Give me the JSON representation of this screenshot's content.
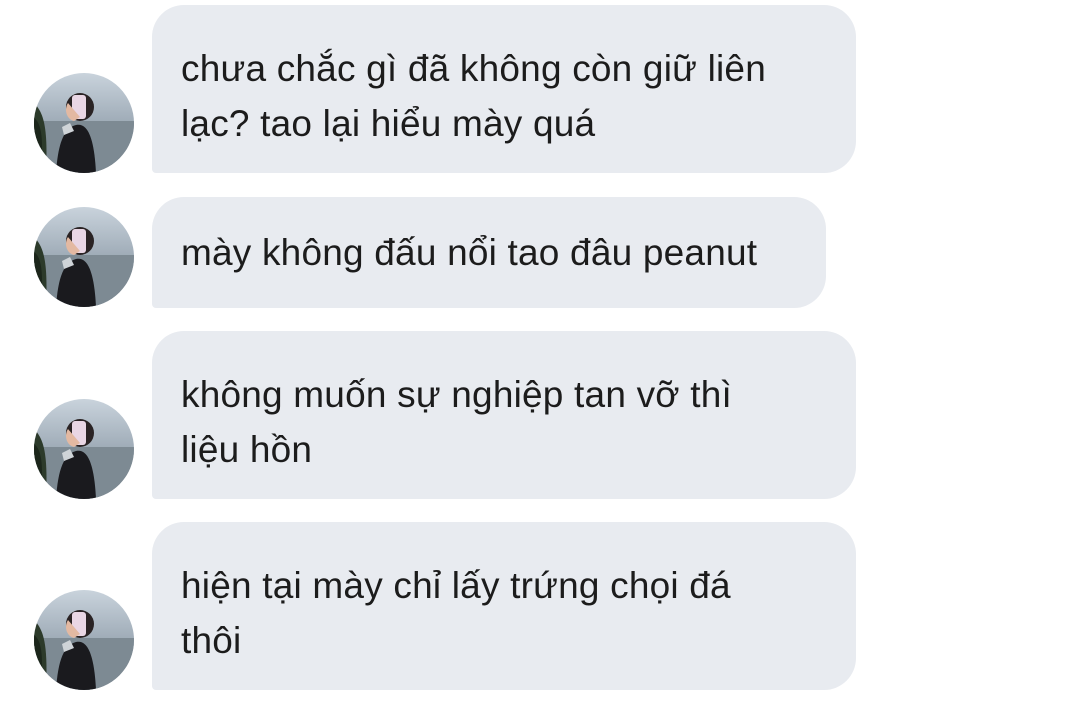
{
  "messages": [
    {
      "text": "chưa chắc gì đã không còn giữ liên\nlạc? tao lại hiểu mày quá"
    },
    {
      "text": "mày không đấu nổi tao đâu peanut"
    },
    {
      "text": "không muốn sự nghiệp tan vỡ thì\nliệu hồn"
    },
    {
      "text": "hiện tại mày chỉ lấy trứng chọi đá\nthôi"
    }
  ],
  "colors": {
    "bubble_bg": "#e8ebf0",
    "text": "#1c1c1c",
    "background": "#ffffff"
  },
  "avatar_icon": "user-photo-icon"
}
